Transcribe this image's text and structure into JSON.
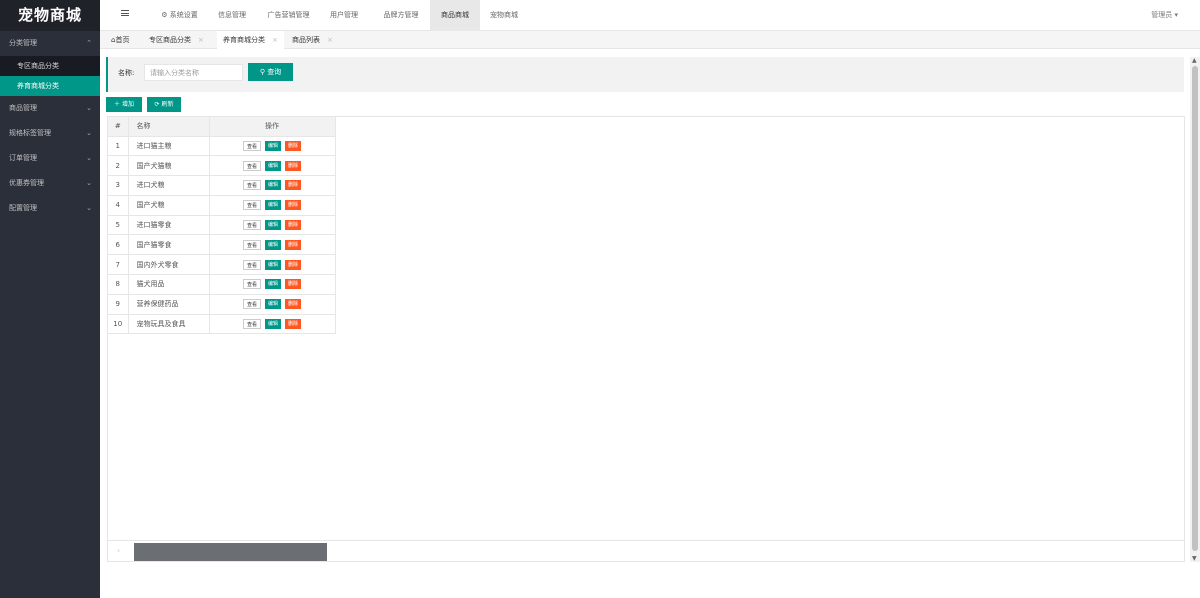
{
  "app": {
    "title": "宠物商城"
  },
  "sidebar": {
    "menus": [
      {
        "label": "分类管理",
        "open": true,
        "items": [
          {
            "label": "专区商品分类"
          },
          {
            "label": "养育商城分类",
            "active": true
          }
        ]
      },
      {
        "label": "商品管理"
      },
      {
        "label": "规格标签管理"
      },
      {
        "label": "订单管理"
      },
      {
        "label": "优惠券管理"
      },
      {
        "label": "配置管理"
      }
    ]
  },
  "topnav": {
    "items": [
      "系统设置",
      "信息管理",
      "广告营销管理",
      "用户管理",
      "品牌方管理",
      "商品商城",
      "宠物商城"
    ],
    "active": "商品商城",
    "user": "管理员"
  },
  "tabs": [
    {
      "label": "首页"
    },
    {
      "label": "专区商品分类"
    },
    {
      "label": "养育商城分类",
      "active": true
    },
    {
      "label": "商品列表"
    }
  ],
  "search": {
    "label": "名称:",
    "placeholder": "请输入分类名称",
    "button": "查询"
  },
  "toolbar": {
    "add": "增加",
    "refresh": "刷新"
  },
  "table": {
    "headers": [
      "#",
      "名称",
      "操作"
    ],
    "actions": {
      "view": "查看",
      "edit": "编辑",
      "delete": "删除"
    },
    "rows": [
      {
        "id": "1",
        "name": "进口猫主粮"
      },
      {
        "id": "2",
        "name": "国产犬猫粮"
      },
      {
        "id": "3",
        "name": "进口犬粮"
      },
      {
        "id": "4",
        "name": "国产犬粮"
      },
      {
        "id": "5",
        "name": "进口猫零食"
      },
      {
        "id": "6",
        "name": "国产猫零食"
      },
      {
        "id": "7",
        "name": "国内外犬零食"
      },
      {
        "id": "8",
        "name": "猫犬用品"
      },
      {
        "id": "9",
        "name": "营养保健药品"
      },
      {
        "id": "10",
        "name": "宠物玩具及食具"
      }
    ]
  },
  "colors": {
    "accent": "#009688",
    "danger": "#ff5722",
    "sidebar": "#2b2f3a"
  }
}
